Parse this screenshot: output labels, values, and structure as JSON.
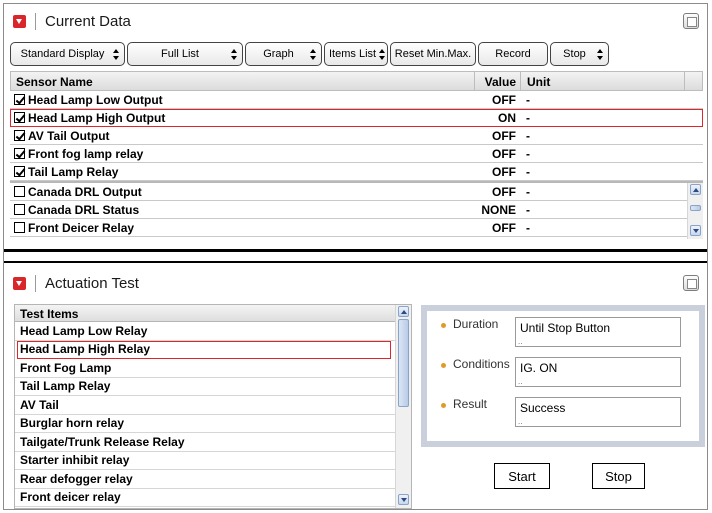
{
  "current_data": {
    "title": "Current Data",
    "toolbar": [
      {
        "label": "Standard Display",
        "select": true,
        "width": 115
      },
      {
        "label": "Full List",
        "select": true,
        "width": 116
      },
      {
        "label": "Graph",
        "select": true,
        "width": 77
      },
      {
        "label": "Items List",
        "select": true,
        "width": 64
      },
      {
        "label": "Reset Min.Max.",
        "select": false,
        "width": 86
      },
      {
        "label": "Record",
        "select": false,
        "width": 70
      },
      {
        "label": "Stop",
        "select": true,
        "width": 59
      }
    ],
    "columns": {
      "name": "Sensor Name",
      "value": "Value",
      "unit": "Unit"
    },
    "checked_rows": [
      {
        "name": "Head Lamp Low Output",
        "value": "OFF",
        "unit": "-",
        "checked": true
      },
      {
        "name": "Head Lamp High Output",
        "value": "ON",
        "unit": "-",
        "checked": true,
        "highlight": true
      },
      {
        "name": "AV Tail Output",
        "value": "OFF",
        "unit": "-",
        "checked": true
      },
      {
        "name": "Front fog lamp relay",
        "value": "OFF",
        "unit": "-",
        "checked": true
      },
      {
        "name": "Tail Lamp Relay",
        "value": "OFF",
        "unit": "-",
        "checked": true
      }
    ],
    "other_rows": [
      {
        "name": "Canada DRL Output",
        "value": "OFF",
        "unit": "-",
        "checked": false
      },
      {
        "name": "Canada DRL Status",
        "value": "NONE",
        "unit": "-",
        "checked": false
      },
      {
        "name": "Front Deicer Relay",
        "value": "OFF",
        "unit": "-",
        "checked": false
      }
    ]
  },
  "actuation_test": {
    "title": "Actuation Test",
    "list_header": "Test Items",
    "items": [
      "Head Lamp Low Relay",
      "Head Lamp High Relay",
      "Front Fog Lamp",
      "Tail Lamp Relay",
      "AV Tail",
      "Burglar horn relay",
      "Tailgate/Trunk Release Relay",
      "Starter inhibit relay",
      "Rear defogger relay",
      "Front deicer relay"
    ],
    "selected_index": 1,
    "fields": [
      {
        "label": "Duration",
        "value": "Until Stop Button"
      },
      {
        "label": "Conditions",
        "value": "IG. ON"
      },
      {
        "label": "Result",
        "value": "Success"
      }
    ],
    "start_label": "Start",
    "stop_label": "Stop"
  },
  "colors": {
    "highlight": "#e0262b",
    "collapse": "#d9262b",
    "bullet": "#e09a2a",
    "info_border": "#c9d0dc"
  }
}
